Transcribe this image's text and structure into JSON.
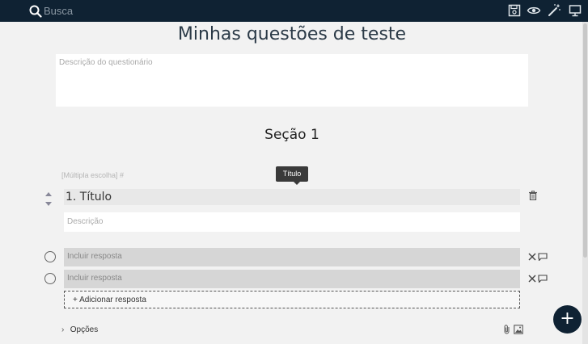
{
  "toolbar": {
    "search_placeholder": "Busca",
    "icons": [
      "save-icon",
      "eye-icon",
      "magic-wand-icon",
      "monitor-icon"
    ]
  },
  "quiz": {
    "title": "Minhas questões de teste",
    "description_placeholder": "Descrição do questionário"
  },
  "section": {
    "title": "Seção 1"
  },
  "question": {
    "type_label": "[Múltipla escolha] #",
    "tooltip": "Título",
    "title": "1. Título",
    "description_placeholder": "Descrição",
    "answers": [
      {
        "placeholder": "Incluir resposta"
      },
      {
        "placeholder": "Incluir resposta"
      }
    ],
    "add_answer_label": "+ Adicionar resposta",
    "options_label": "Opções"
  },
  "fab": {
    "label": "+"
  },
  "colors": {
    "topbar": "#0f2233",
    "background": "#f2f2f2",
    "answer_field": "#d6d6d6"
  }
}
